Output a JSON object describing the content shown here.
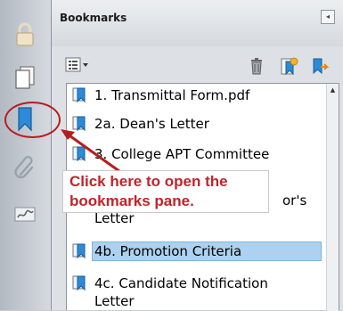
{
  "panel": {
    "title": "Bookmarks",
    "collapse_glyph": "◂"
  },
  "left_rail": [
    {
      "name": "lock-icon"
    },
    {
      "name": "pages-icon"
    },
    {
      "name": "bookmarks-icon"
    },
    {
      "name": "attachments-icon"
    },
    {
      "name": "signatures-icon"
    }
  ],
  "toolbar": {
    "options_icon": "options-menu-icon",
    "options_caret": "▾",
    "icons": [
      "trash-icon",
      "new-bookmark-icon",
      "expand-bookmark-icon"
    ]
  },
  "bookmarks": [
    {
      "label": "1.  Transmittal Form.pdf",
      "selected": false
    },
    {
      "label": "2a.  Dean's Letter",
      "selected": false
    },
    {
      "label": "3.  College APT Committee",
      "selected": false
    },
    {
      "label": "or's",
      "selected": false
    },
    {
      "label": "Letter",
      "selected": false
    },
    {
      "label": "4b.  Promotion Criteria",
      "selected": true
    },
    {
      "label": "4c.  Candidate Notification",
      "selected": false
    },
    {
      "label": "Letter",
      "selected": false
    }
  ],
  "scrollbar": {
    "up_glyph": "▲"
  },
  "callout": {
    "line1": "Click here to open the",
    "line2": "bookmarks pane.",
    "color": "#c0242b"
  },
  "colors": {
    "highlight_circle": "#b61d1d",
    "selection_bg": "#add1ee",
    "rail_icon": "#1a6fb8"
  }
}
